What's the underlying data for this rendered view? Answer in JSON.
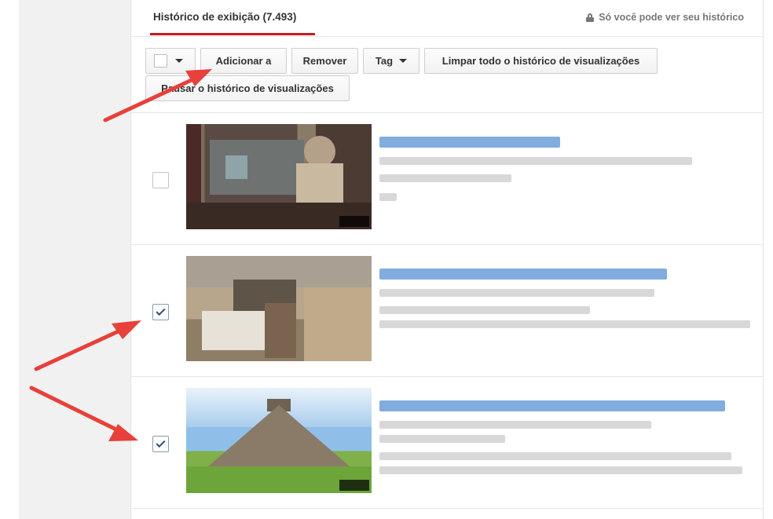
{
  "header": {
    "title": "Histórico de exibição (7.493)",
    "privacy_note": "Só você pode ver seu histórico"
  },
  "toolbar": {
    "add_label": "Adicionar a",
    "remove_label": "Remover",
    "tag_label": "Tag",
    "clear_label": "Limpar todo o histórico de visualizações",
    "pause_label": "Pausar o histórico de visualizações"
  },
  "videos": [
    {
      "checked": false
    },
    {
      "checked": true
    },
    {
      "checked": true
    }
  ],
  "colors": {
    "accent_red": "#cc181e",
    "annotation_arrow": "#e8403a",
    "link_blue": "#6b9ed8"
  }
}
